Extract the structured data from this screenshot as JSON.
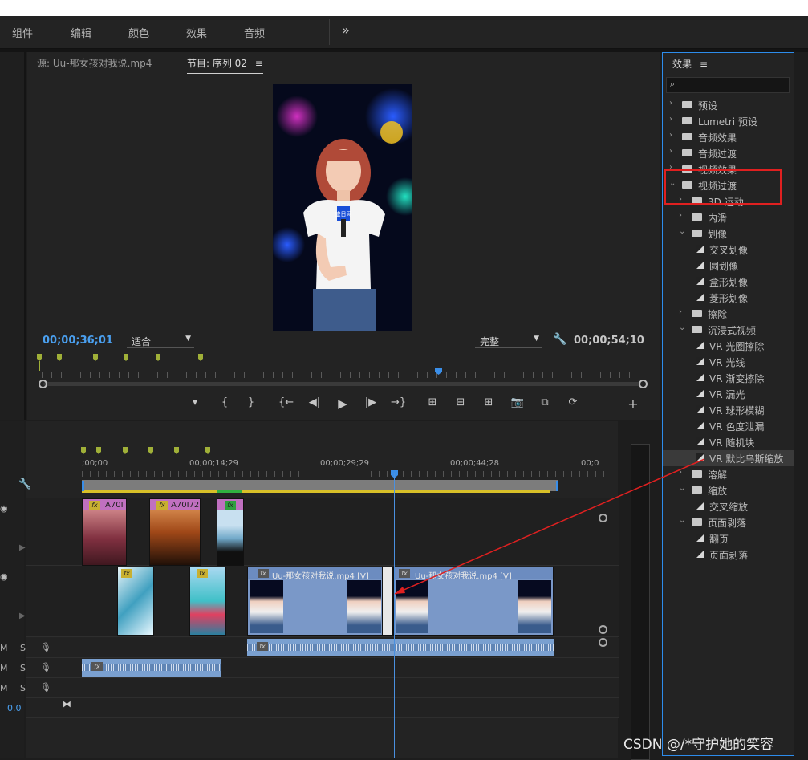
{
  "menu": {
    "items": [
      "组件",
      "编辑",
      "颜色",
      "效果",
      "音频"
    ],
    "more": "»"
  },
  "monitor": {
    "source_tab": "源: Uu-那女孩对我说.mp4",
    "program_tab": "节目: 序列 02",
    "tab_menu": "≡",
    "timecode_current": "00;00;36;01",
    "fit_select": "适合",
    "quality_select": "完整",
    "timecode_duration": "00;00;54;10",
    "wrench": "🔧",
    "mic_badge": "盛日网",
    "controls": [
      "▾",
      "{",
      "}",
      "{←",
      "◀|",
      "▶",
      "|▶",
      "→}",
      "⊞",
      "⊟",
      "⊞",
      "📷",
      "⧉",
      "⟳",
      "+"
    ]
  },
  "effects": {
    "title": "效果",
    "menu_icon": "≡",
    "search_placeholder": "",
    "tree": [
      {
        "label": "预设",
        "level": 0,
        "type": "folder-star",
        "expanded": false
      },
      {
        "label": "Lumetri 预设",
        "level": 0,
        "type": "folder-star",
        "expanded": false
      },
      {
        "label": "音频效果",
        "level": 0,
        "type": "folder",
        "expanded": false
      },
      {
        "label": "音频过渡",
        "level": 0,
        "type": "folder",
        "expanded": false
      },
      {
        "label": "视频效果",
        "level": 0,
        "type": "folder",
        "expanded": false
      },
      {
        "label": "视频过渡",
        "level": 0,
        "type": "folder",
        "expanded": true
      },
      {
        "label": "3D 运动",
        "level": 1,
        "type": "folder",
        "expanded": false
      },
      {
        "label": "内滑",
        "level": 1,
        "type": "folder",
        "expanded": false
      },
      {
        "label": "划像",
        "level": 1,
        "type": "folder",
        "expanded": true
      },
      {
        "label": "交叉划像",
        "level": 2,
        "type": "transition"
      },
      {
        "label": "圆划像",
        "level": 2,
        "type": "transition"
      },
      {
        "label": "盒形划像",
        "level": 2,
        "type": "transition"
      },
      {
        "label": "菱形划像",
        "level": 2,
        "type": "transition"
      },
      {
        "label": "擦除",
        "level": 1,
        "type": "folder",
        "expanded": false
      },
      {
        "label": "沉浸式视频",
        "level": 1,
        "type": "folder",
        "expanded": true
      },
      {
        "label": "VR 光圈擦除",
        "level": 2,
        "type": "transition"
      },
      {
        "label": "VR 光线",
        "level": 2,
        "type": "transition"
      },
      {
        "label": "VR 渐变擦除",
        "level": 2,
        "type": "transition"
      },
      {
        "label": "VR 漏光",
        "level": 2,
        "type": "transition"
      },
      {
        "label": "VR 球形模糊",
        "level": 2,
        "type": "transition"
      },
      {
        "label": "VR 色度泄漏",
        "level": 2,
        "type": "transition"
      },
      {
        "label": "VR 随机块",
        "level": 2,
        "type": "transition"
      },
      {
        "label": "VR 默比乌斯缩放",
        "level": 2,
        "type": "transition",
        "selected": true
      },
      {
        "label": "溶解",
        "level": 1,
        "type": "folder",
        "expanded": false
      },
      {
        "label": "缩放",
        "level": 1,
        "type": "folder",
        "expanded": true
      },
      {
        "label": "交叉缩放",
        "level": 2,
        "type": "transition"
      },
      {
        "label": "页面剥落",
        "level": 1,
        "type": "folder",
        "expanded": true
      },
      {
        "label": "翻页",
        "level": 2,
        "type": "transition"
      },
      {
        "label": "页面剥落",
        "level": 2,
        "type": "transition"
      }
    ]
  },
  "timeline": {
    "ruler": [
      ";00;00",
      "00;00;14;29",
      "00;00;29;29",
      "00;00;44;28",
      "00;0"
    ],
    "clips_v2": [
      {
        "label": "A70I",
        "fx": "fx"
      },
      {
        "label": "A70I72",
        "fx": "fx"
      },
      {
        "label": "",
        "fx": "fx"
      }
    ],
    "clips_v1": [
      {
        "label": "",
        "fx": "fx"
      },
      {
        "label": "",
        "fx": "fx"
      },
      {
        "label": "Uu-那女孩对我说.mp4 [V]",
        "fx": "fx"
      },
      {
        "label": "Uu-那女孩对我说.mp4 [V]",
        "fx": "fx"
      }
    ],
    "audio_tracks": [
      {
        "m": "M",
        "s": "S",
        "mic": "🎙"
      },
      {
        "m": "M",
        "s": "S",
        "mic": "🎙"
      },
      {
        "m": "M",
        "s": "S",
        "mic": "🎙"
      }
    ],
    "volume_value": "0.0",
    "mini_fx": "fx"
  },
  "watermark": "CSDN @/*守护她的笑容"
}
